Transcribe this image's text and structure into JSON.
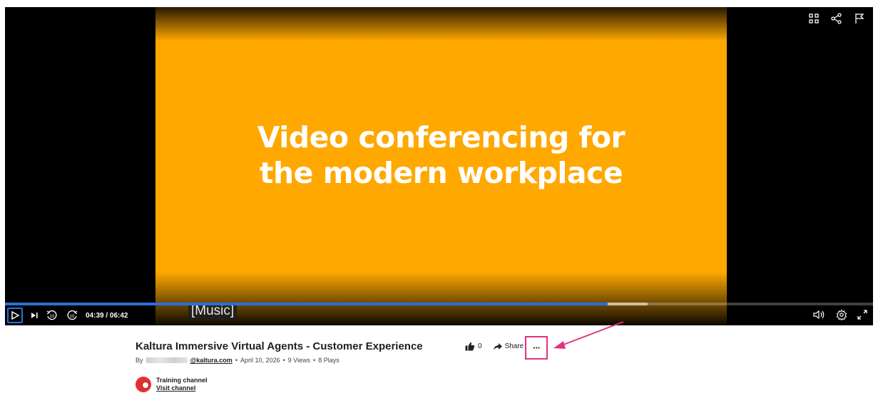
{
  "player": {
    "slide_text": "Video conferencing for\nthe modern workplace",
    "caption": "[Music]",
    "time_display": "04:39 / 06:42",
    "played_fraction": 0.694,
    "buffered_until_fraction": 0.74,
    "top_icons": [
      "grid-icon",
      "share-icon",
      "flag-icon"
    ],
    "left_icons": [
      "play-icon",
      "next-icon",
      "rewind-10-icon",
      "forward-10-icon"
    ],
    "right_icons": [
      "volume-icon",
      "settings-icon",
      "fullscreen-icon"
    ],
    "colors": {
      "slide_bg": "#ffa800",
      "progress": "#2a6fdb"
    }
  },
  "video": {
    "title": "Kaltura Immersive Virtual Agents - Customer Experience",
    "by_label": "By",
    "author_domain": "@kaltura.com",
    "date": "April 10, 2026",
    "views": "9 Views",
    "plays": "8 Plays"
  },
  "actions": {
    "like_count": "0",
    "share_label": "Share",
    "more_label": "···"
  },
  "channel": {
    "name": "Training channel",
    "visit_label": "Visit channel"
  },
  "annotation": {
    "highlight_color": "#e0327f"
  }
}
